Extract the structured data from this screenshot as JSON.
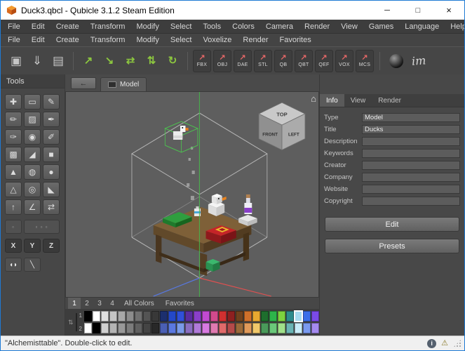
{
  "window": {
    "title": "Duck3.qbcl - Qubicle 3.1.2 Steam Edition",
    "minimize": "─",
    "maximize": "□",
    "close": "×"
  },
  "menubar1": [
    "File",
    "Edit",
    "Create",
    "Transform",
    "Modify",
    "Select",
    "Tools",
    "Colors",
    "Camera",
    "Render",
    "View",
    "Games",
    "Language",
    "Help"
  ],
  "menubar2": [
    "File",
    "Edit",
    "Create",
    "Transform",
    "Modify",
    "Select",
    "Voxelize",
    "Render",
    "Favorites"
  ],
  "toolbar": {
    "file_group": [
      {
        "name": "new-matrix-icon",
        "glyph": "▣"
      },
      {
        "name": "import-icon",
        "glyph": "⇓"
      },
      {
        "name": "save-icon",
        "glyph": "▤"
      }
    ],
    "green_group": [
      {
        "name": "arrow-up-right-icon",
        "glyph": "↗"
      },
      {
        "name": "arrow-down-right-icon",
        "glyph": "↘"
      },
      {
        "name": "swap-horizontal-icon",
        "glyph": "⇄"
      },
      {
        "name": "swap-vertical-icon",
        "glyph": "⇅"
      },
      {
        "name": "rotate-icon",
        "glyph": "↻"
      }
    ],
    "formats": [
      "FBX",
      "OBJ",
      "DAE",
      "STL",
      "QB",
      "QBT",
      "QEF",
      "VOX",
      "MCS"
    ],
    "format_arrow": "↗",
    "arrow_color": "#e06666",
    "green_color": "#8cc63f",
    "signature": "im"
  },
  "tools": {
    "title": "Tools",
    "grid": [
      {
        "name": "move",
        "glyph": "✚"
      },
      {
        "name": "select",
        "glyph": "▭"
      },
      {
        "name": "pencil",
        "glyph": "✎"
      },
      {
        "name": "attach",
        "glyph": "✏"
      },
      {
        "name": "erase",
        "glyph": "▨"
      },
      {
        "name": "paint",
        "glyph": "✒"
      },
      {
        "name": "brush",
        "glyph": "✑"
      },
      {
        "name": "fill",
        "glyph": "◉"
      },
      {
        "name": "pick-color",
        "glyph": "✐"
      },
      {
        "name": "box",
        "glyph": "▩"
      },
      {
        "name": "wedge",
        "glyph": "◢"
      },
      {
        "name": "rectangle",
        "glyph": "■"
      },
      {
        "name": "pyramid",
        "glyph": "▲"
      },
      {
        "name": "cylinder",
        "glyph": "◍"
      },
      {
        "name": "sphere",
        "glyph": "●"
      },
      {
        "name": "cone",
        "glyph": "△"
      },
      {
        "name": "tube",
        "glyph": "◎"
      },
      {
        "name": "prism",
        "glyph": "◣"
      },
      {
        "name": "extrude",
        "glyph": "↑"
      },
      {
        "name": "measure",
        "glyph": "∠"
      },
      {
        "name": "mirror",
        "glyph": "⇄"
      }
    ],
    "mode_buttons": [
      {
        "name": "single-matrix-mode",
        "glyph": "▫"
      },
      {
        "name": "multi-matrix-mode",
        "glyph": "▫ ▫ ▫"
      }
    ],
    "axes": [
      "X",
      "Y",
      "Z"
    ],
    "extra": [
      {
        "name": "mask-tool",
        "glyph": "◖◗"
      },
      {
        "name": "line-tool",
        "glyph": "╲"
      }
    ]
  },
  "viewport": {
    "back_glyph": "←",
    "tab_label": "Model",
    "home_glyph": "⌂",
    "nav_cube": {
      "top": "TOP",
      "front": "FRONT",
      "left": "LEFT"
    },
    "axis_x_color": "#e05050",
    "axis_y_color": "#46b44a",
    "axis_z_color": "#5878e0"
  },
  "info_panel": {
    "tabs": [
      "Info",
      "View",
      "Render"
    ],
    "active": "Info",
    "fields": [
      {
        "label": "Type",
        "value": "Model"
      },
      {
        "label": "Title",
        "value": "Ducks"
      },
      {
        "label": "Description",
        "value": ""
      },
      {
        "label": "Keywords",
        "value": ""
      },
      {
        "label": "Creator",
        "value": ""
      },
      {
        "label": "Company",
        "value": ""
      },
      {
        "label": "Website",
        "value": ""
      },
      {
        "label": "Copyright",
        "value": ""
      }
    ],
    "buttons": [
      "Edit",
      "Presets"
    ]
  },
  "palette": {
    "tabs": [
      "1",
      "2",
      "3",
      "4"
    ],
    "active_tab": "1",
    "views": [
      "All Colors",
      "Favorites"
    ],
    "scroll_glyph": "⇅",
    "row_labels": [
      "1",
      "2"
    ],
    "current_color_top": "#8a7048",
    "current_color_bottom": "#2e2518",
    "selected": {
      "row": 0,
      "col": 25
    },
    "rows": [
      [
        "#000000",
        "#ffffff",
        "#e0e0e0",
        "#c4c4c4",
        "#a8a8a8",
        "#8c8c8c",
        "#707070",
        "#545454",
        "#383838",
        "#1c2f6e",
        "#2448c8",
        "#3050d8",
        "#5a2da0",
        "#8a3fc9",
        "#c24ad2",
        "#d24a8c",
        "#d03030",
        "#8e2020",
        "#70421e",
        "#d0702a",
        "#e8a830",
        "#1e6e2d",
        "#2db44a",
        "#7dd23f",
        "#2d8c8c",
        "#a8dcf0",
        "#3a6ee8",
        "#7a4ae8",
        "#e84ab0",
        "#f0e0a0"
      ],
      [
        "#ffffff",
        "#000000",
        "#d0d0d0",
        "#b4b4b4",
        "#989898",
        "#7c7c7c",
        "#606060",
        "#444444",
        "#282828",
        "#4a5fb4",
        "#5a78e0",
        "#7a9ae8",
        "#8a6ec0",
        "#b07ad8",
        "#d87ae0",
        "#e07ab0",
        "#e06a6a",
        "#b44a4a",
        "#9a6a3a",
        "#e09a5a",
        "#f0c86a",
        "#4a9a5a",
        "#6ac87a",
        "#a0e08a",
        "#6ab4b4",
        "#c8ecf8",
        "#7a9af0",
        "#a58af0",
        "#f08ad0",
        "#f8f060"
      ]
    ]
  },
  "statusbar": {
    "text": "\"Alchemisttable\". Double-click to edit.",
    "info_glyph": "i",
    "warning_glyph": "⚠"
  }
}
